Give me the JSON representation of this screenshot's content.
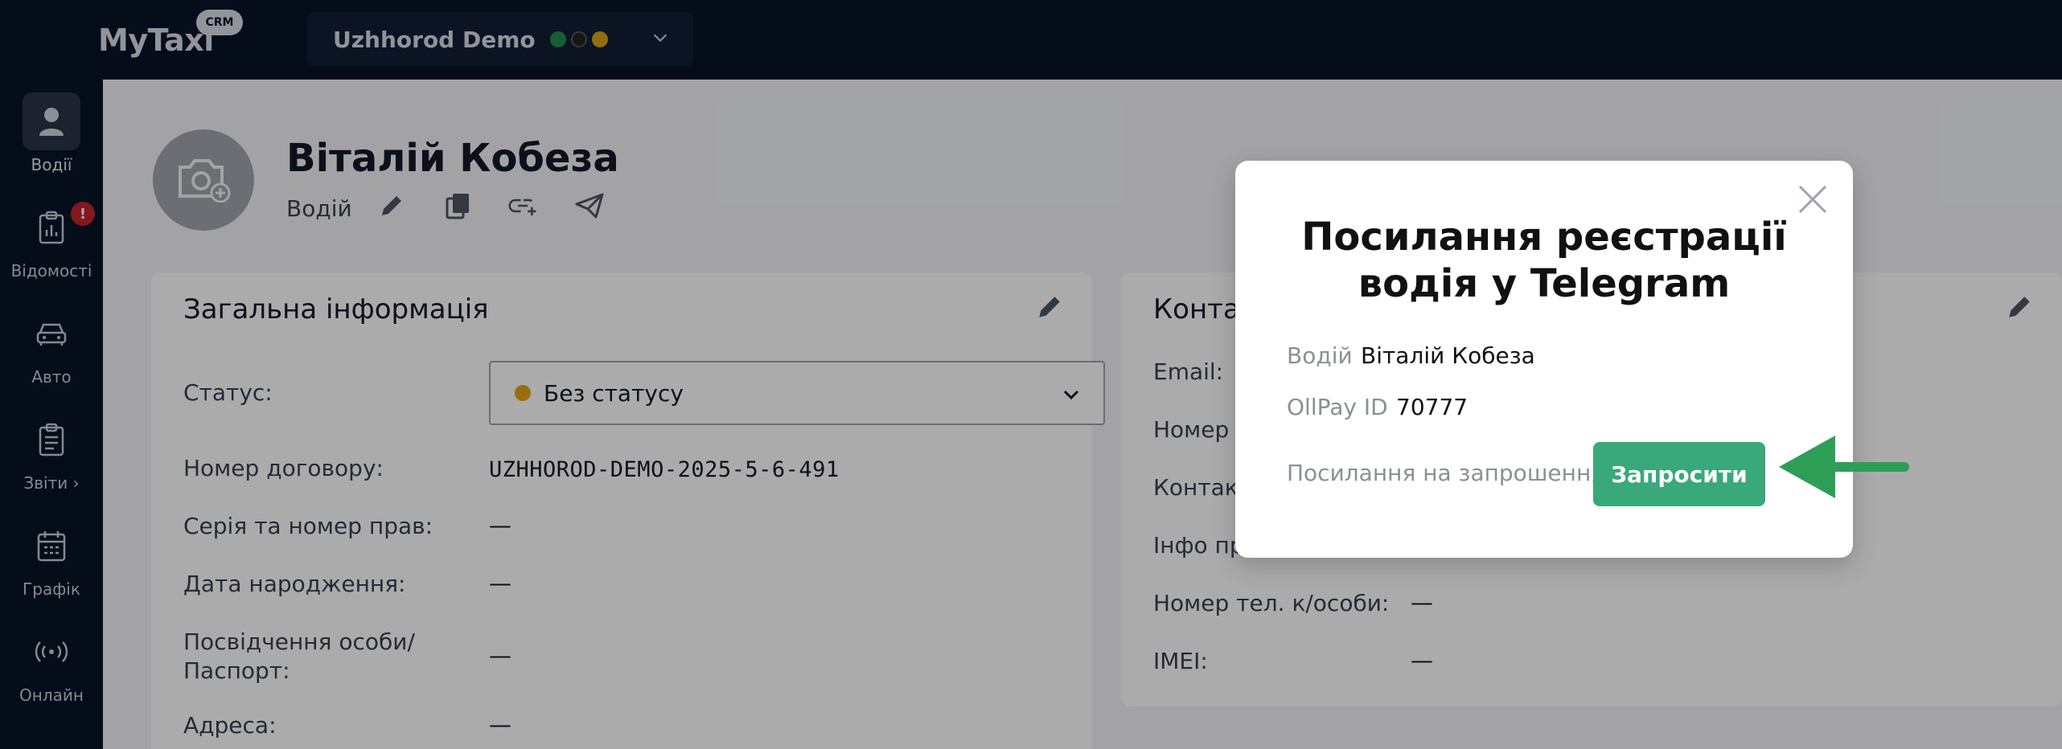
{
  "app": {
    "logo": "MyTaxi",
    "logo_badge": "CRM"
  },
  "org_selector": {
    "name": "Uzhhorod Demo",
    "dot_colors": [
      "#1f8f4e",
      "#111111",
      "#d6a51c"
    ]
  },
  "sidebar": {
    "items": [
      {
        "label": "Водії",
        "icon": "user-icon",
        "active": true
      },
      {
        "label": "Відомості",
        "icon": "clipboard-chart-icon",
        "badge": "!"
      },
      {
        "label": "Авто",
        "icon": "car-icon"
      },
      {
        "label": "Звіти",
        "icon": "report-icon",
        "suffix": "›"
      },
      {
        "label": "Графік",
        "icon": "calendar-icon"
      },
      {
        "label": "Онлайн",
        "icon": "broadcast-icon"
      }
    ]
  },
  "profile": {
    "name": "Віталій Кобеза",
    "role": "Водій"
  },
  "general_info": {
    "title": "Загальна інформація",
    "status_label": "Статус:",
    "status_value": "Без статусу",
    "rows": [
      {
        "label": "Номер договору:",
        "value": "UZHHOROD-DEMO-2025-5-6-491"
      },
      {
        "label": "Серія та номер прав:",
        "value": "—"
      },
      {
        "label": "Дата народження:",
        "value": "—"
      },
      {
        "label": "Посвідчення особи/\nПаспорт:",
        "value": "—"
      },
      {
        "label": "Адреса:",
        "value": "—"
      }
    ]
  },
  "contacts": {
    "title_partial": "Конта",
    "rows": [
      {
        "label": "Email:",
        "value": ""
      },
      {
        "label": "Номер т",
        "value": ""
      },
      {
        "label": "Контакт",
        "value": ""
      },
      {
        "label": "Інфо пр",
        "value": ""
      },
      {
        "label": "Номер тел. к/особи:",
        "value": "—"
      },
      {
        "label": "IMEI:",
        "value": "—"
      }
    ]
  },
  "modal": {
    "title_line1": "Посилання реєстрації",
    "title_line2": "водія у Telegram",
    "driver_label": "Водій",
    "driver_value": "Віталій Кобеза",
    "ollpay_label": "OllPay ID",
    "ollpay_value": "70777",
    "invite_label": "Посилання на запрошення",
    "invite_button": "Запросити"
  },
  "colors": {
    "topbar": "#0a1428",
    "accent_green": "#39a87a",
    "arrow_green": "#2e9e57"
  }
}
